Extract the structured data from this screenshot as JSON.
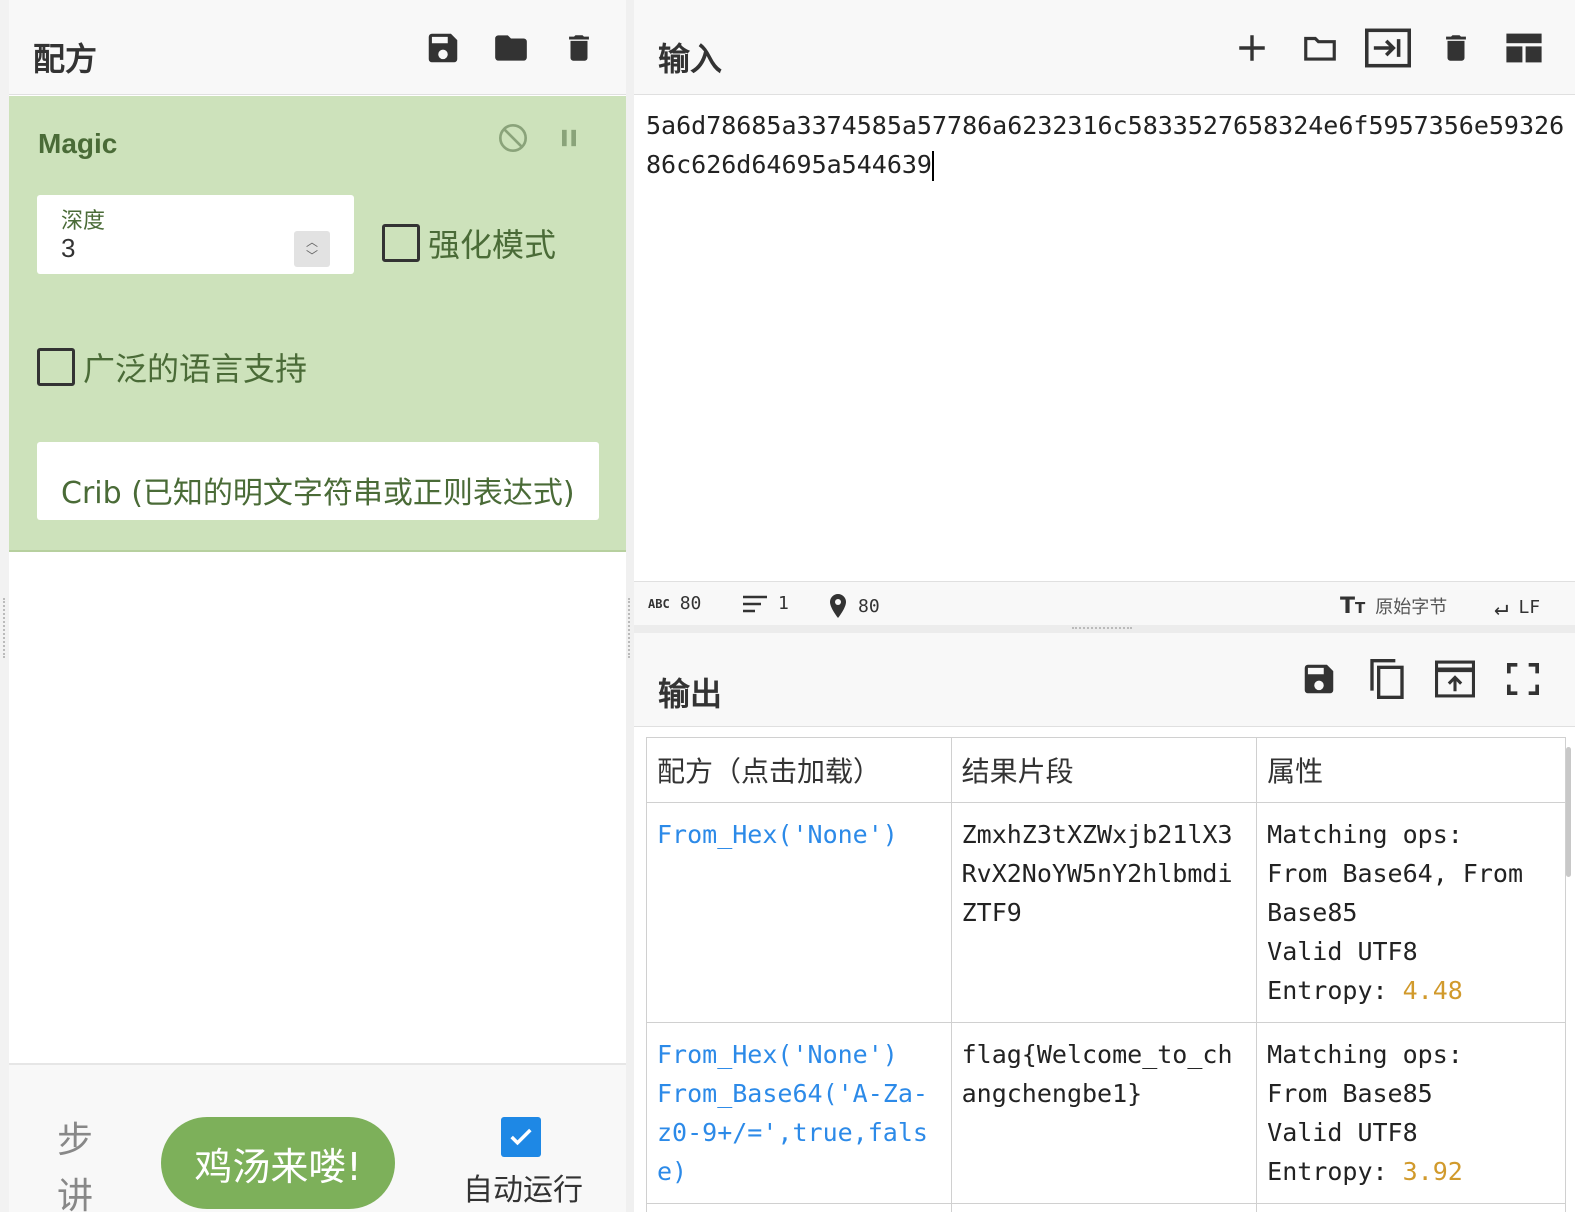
{
  "recipe_panel": {
    "title": "配方",
    "icons": [
      "save-icon",
      "folder-icon",
      "trash-icon"
    ]
  },
  "operation": {
    "name": "Magic",
    "depth_label": "深度",
    "depth_value": "3",
    "intensive_label": "强化模式",
    "extensive_label": "广泛的语言支持",
    "crib_placeholder": "Crib (已知的明文字符串或正则表达式)"
  },
  "controls": {
    "step_label": "步讲",
    "bake_label": "鸡汤来喽!",
    "autobake_label": "自动运行",
    "autobake_checked": true
  },
  "input": {
    "title": "输入",
    "text": "5a6d78685a3374585a57786a6232316c5833527658324e6f5957356e5932686c626d64695a544639",
    "icons": [
      "plus-icon",
      "folder-icon",
      "input-file-icon",
      "trash-icon",
      "layout-icon"
    ]
  },
  "status": {
    "length": "80",
    "lines": "1",
    "position": "80",
    "encoding": "原始字节",
    "eol": "LF"
  },
  "output": {
    "title": "输出",
    "icons": [
      "save-icon",
      "copy-icon",
      "replace-input-icon",
      "fullscreen-icon"
    ],
    "columns": [
      "配方（点击加载）",
      "结果片段",
      "属性"
    ],
    "rows": [
      {
        "recipe": "From_Hex('None')",
        "result": "ZmxhZ3tXZWxjb21lX3RvX2NoYW5nY2hlbmdiZTF9",
        "props_line1": "Matching ops:",
        "props_line2": "From Base64, From Base85",
        "props_line3": "Valid UTF8",
        "entropy_label": "Entropy: ",
        "entropy": "4.48"
      },
      {
        "recipe": "From_Hex('None')\nFrom_Base64('A-Za-z0-9+/=',true,false)",
        "result": "flag{Welcome_to_changchengbe1}",
        "props_line1": "Matching ops:",
        "props_line2": "From Base85",
        "props_line3": "Valid UTF8",
        "entropy_label": "Entropy: ",
        "entropy": "3.92"
      }
    ]
  }
}
